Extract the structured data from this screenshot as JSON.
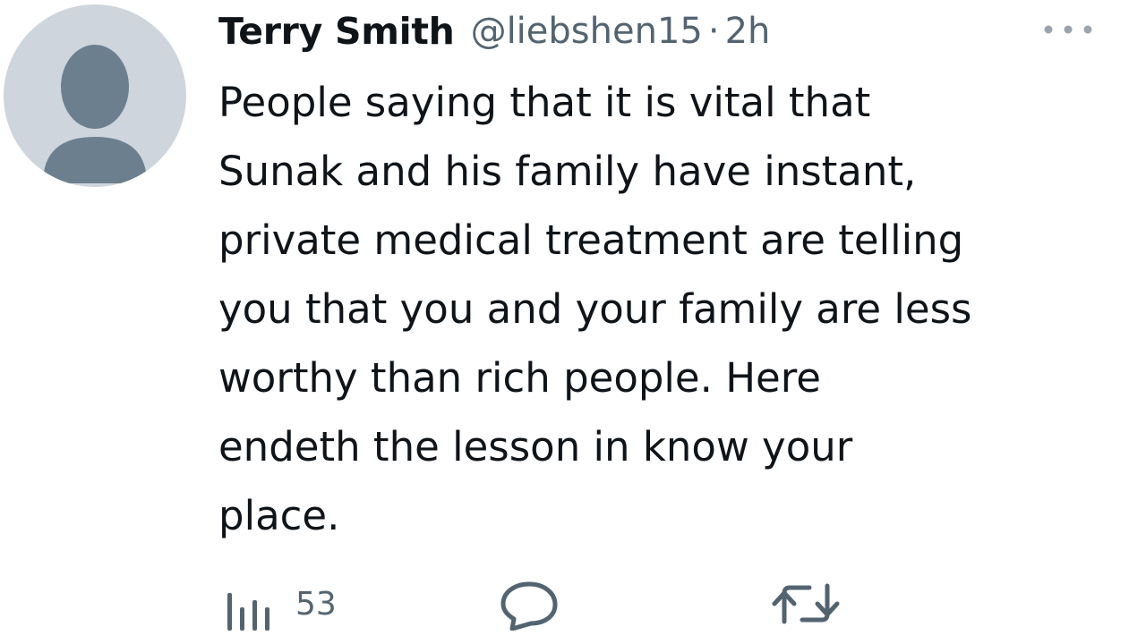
{
  "author": {
    "name": "Terry Smith",
    "handle": "@liebshen15",
    "separator": "·",
    "time": "2h",
    "avatar_icon": "default-avatar-icon"
  },
  "tweet": {
    "text_lines": [
      "People saying that it is vital that",
      "Sunak and his family have instant,",
      "private medical treatment are telling",
      "you that you and your family are less",
      "worthy than rich people. Here",
      "endeth the lesson in know your",
      "place."
    ]
  },
  "actions": {
    "views": {
      "icon": "views-chart-icon",
      "count": "53"
    },
    "reply": {
      "icon": "reply-bubble-icon"
    },
    "retweet": {
      "icon": "retweet-icon"
    },
    "more": {
      "icon": "more-dots-icon"
    }
  },
  "colors": {
    "text_primary": "#0f1419",
    "text_secondary": "#536471",
    "avatar_bg": "#ced5dc",
    "avatar_fg": "#6b7f8f"
  }
}
